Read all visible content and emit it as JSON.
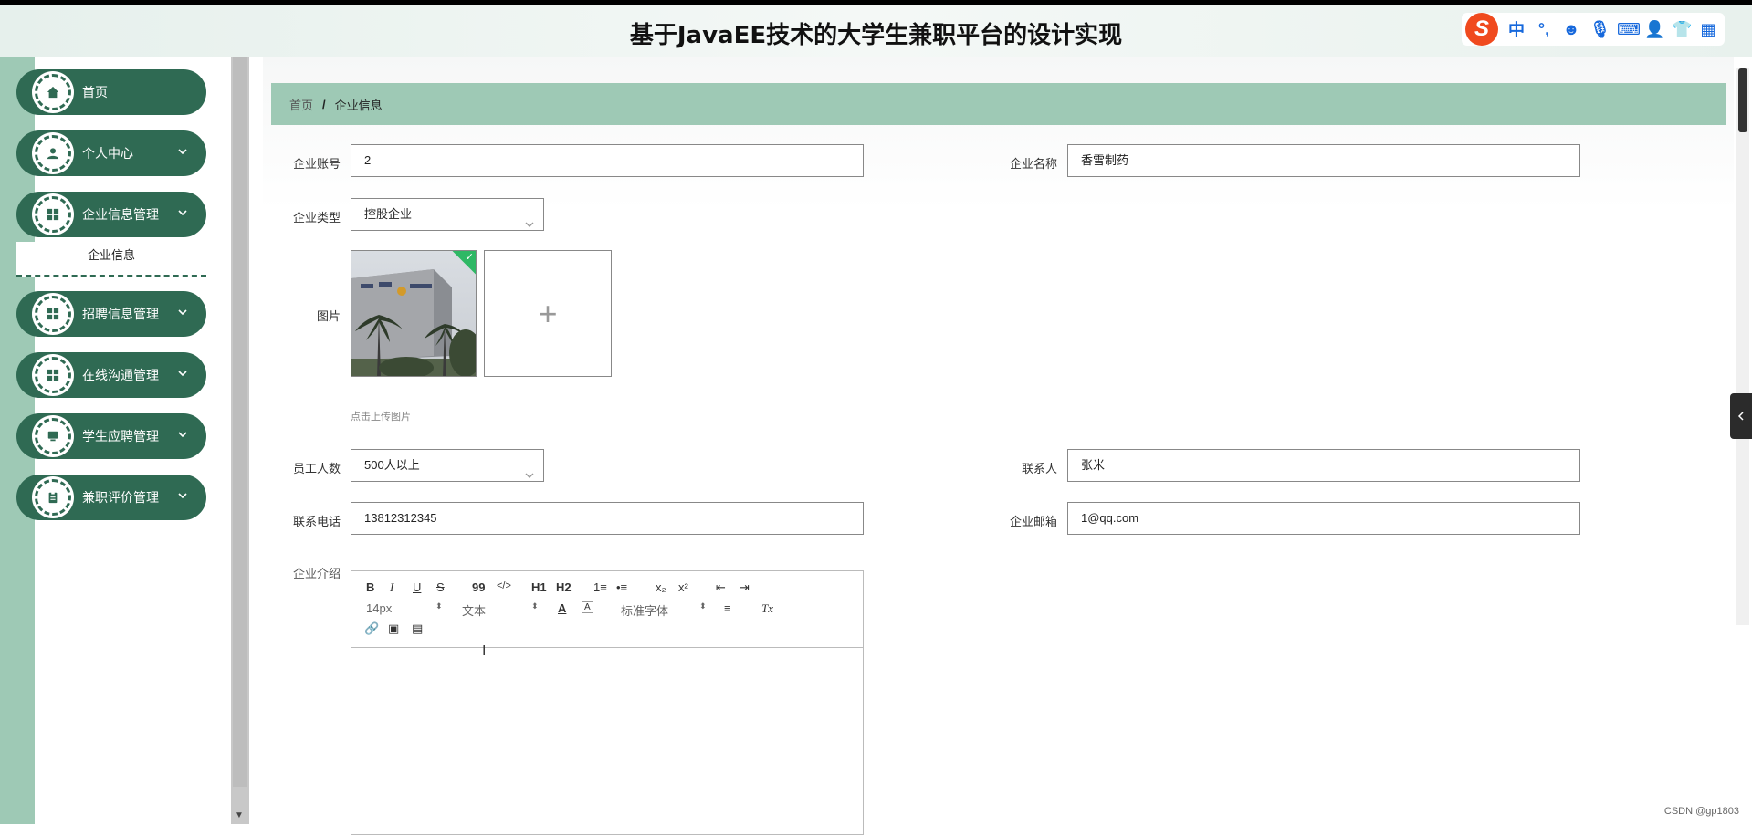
{
  "app": {
    "title": "基于JavaEE技术的大学生兼职平台的设计实现"
  },
  "ime": {
    "logo": "S",
    "mode": "中",
    "punct": "°,",
    "items": [
      "emoji-icon",
      "mic-icon",
      "keyboard-icon",
      "user-icon",
      "shirt-icon",
      "apps-icon"
    ]
  },
  "sidebar": {
    "items": [
      {
        "label": "首页",
        "icon": "home-icon",
        "has_chevron": false
      },
      {
        "label": "个人中心",
        "icon": "user-icon",
        "has_chevron": true
      },
      {
        "label": "企业信息管理",
        "icon": "grid-icon",
        "has_chevron": true
      },
      {
        "label": "招聘信息管理",
        "icon": "grid-icon",
        "has_chevron": true
      },
      {
        "label": "在线沟通管理",
        "icon": "grid-icon",
        "has_chevron": true
      },
      {
        "label": "学生应聘管理",
        "icon": "monitor-icon",
        "has_chevron": true
      },
      {
        "label": "兼职评价管理",
        "icon": "clipboard-icon",
        "has_chevron": true
      }
    ],
    "submenu": {
      "label": "企业信息"
    }
  },
  "breadcrumb": {
    "home": "首页",
    "separator": "/",
    "current": "企业信息"
  },
  "form": {
    "account": {
      "label": "企业账号",
      "value": "2"
    },
    "name": {
      "label": "企业名称",
      "value": "香雪制药"
    },
    "type": {
      "label": "企业类型",
      "value": "控股企业"
    },
    "image": {
      "label": "图片",
      "tip": "点击上传图片",
      "add": "+"
    },
    "employees": {
      "label": "员工人数",
      "value": "500人以上"
    },
    "contact": {
      "label": "联系人",
      "value": "张米"
    },
    "phone": {
      "label": "联系电话",
      "value": "13812312345"
    },
    "email": {
      "label": "企业邮箱",
      "value": "1@qq.com"
    },
    "intro": {
      "label": "企业介绍"
    }
  },
  "editor": {
    "buttons": {
      "bold": "B",
      "italic": "I",
      "underline": "U",
      "strike": "S",
      "quote": "99",
      "code": "</>",
      "h1": "H1",
      "h2": "H2",
      "ol": "1≡",
      "ul": "•≡",
      "sub": "x₂",
      "sup": "x²",
      "outdent": "⇤",
      "indent": "⇥"
    },
    "size": "14px",
    "header": "文本",
    "font": "标准字体",
    "color": "A",
    "background": "A",
    "align": "≡",
    "clean": "Tx"
  },
  "watermark": "CSDN @gp1803"
}
